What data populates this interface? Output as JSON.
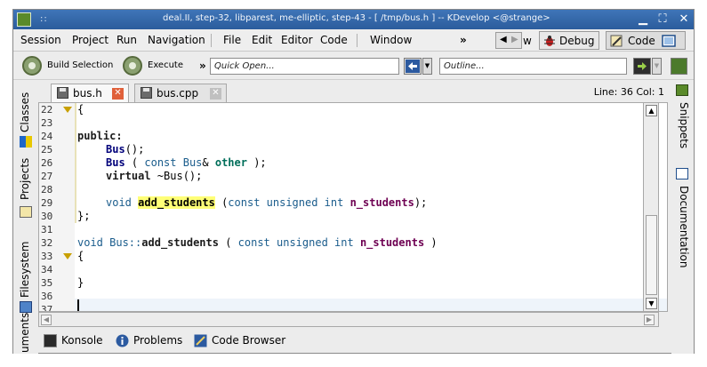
{
  "window": {
    "title": "deal.II, step-32, libparest, me-elliptic, step-43 - [ /tmp/bus.h ] -- KDevelop <@strange>"
  },
  "menu": {
    "items": [
      "Session",
      "Project",
      "Run",
      "Navigation",
      "File",
      "Edit",
      "Editor",
      "Code",
      "Window"
    ],
    "overflow": "»",
    "partial_area_label": "w",
    "debug_label": "Debug",
    "code_label": "Code"
  },
  "toolbar": {
    "build_label": "Build Selection",
    "execute_label": "Execute",
    "overflow": "»",
    "quick_open_placeholder": "Quick Open...",
    "outline_placeholder": "Outline..."
  },
  "left_tools": [
    "Classes",
    "Projects",
    "Filesystem",
    "uments"
  ],
  "right_tools": [
    "Snippets",
    "Documentation"
  ],
  "tabs": [
    {
      "label": "bus.h",
      "active": true
    },
    {
      "label": "bus.cpp",
      "active": false
    }
  ],
  "cursor_position": "Line: 36 Col: 1",
  "editor": {
    "line_numbers": [
      "22",
      "23",
      "24",
      "25",
      "26",
      "27",
      "28",
      "29",
      "30",
      "31",
      "32",
      "33",
      "34",
      "35",
      "36",
      "37"
    ],
    "code": {
      "l22": "{",
      "l24_kw": "public",
      "l24_rest": ":",
      "l25_name": "Bus",
      "l25_rest": "();",
      "l26_name": "Bus",
      "l26_a": " ( ",
      "l26_const": "const",
      "l26_type": " Bus",
      "l26_amp": "& ",
      "l26_param": "other",
      "l26_end": " );",
      "l27_kw": "virtual",
      "l27_rest": " ~Bus();",
      "l29_void": "void",
      "l29_fn": "add_students",
      "l29_a": " (",
      "l29_type": "const unsigned int",
      "l29_sp": " ",
      "l29_param": "n_students",
      "l29_end": ");",
      "l30": "};",
      "l32_void": "void",
      "l32_cls": " Bus::",
      "l32_fn": "add_students",
      "l32_a": " ( ",
      "l32_type": "const unsigned int",
      "l32_sp": " ",
      "l32_param": "n_students",
      "l32_end": " )",
      "l33": "{",
      "l35": "}"
    }
  },
  "bottom_tools": [
    "Konsole",
    "Problems",
    "Code Browser"
  ],
  "colors": {
    "titlebar": "#3366aa",
    "highlight": "#ffff77",
    "keyword_type": "#1a5c8c",
    "parameter": "#6e0052",
    "member": "#006e5a",
    "close_tab_active": "#e0603a",
    "close_tab_inactive": "#c0c0c0"
  }
}
